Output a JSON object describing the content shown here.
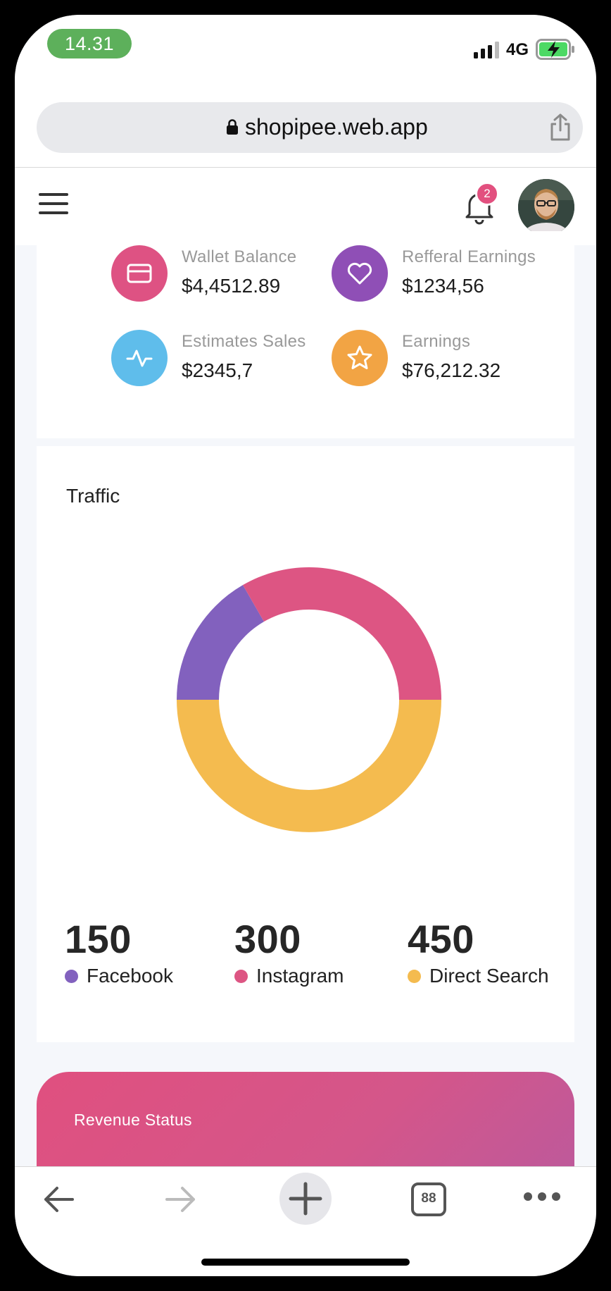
{
  "status_bar": {
    "time": "14.31",
    "network": "4G"
  },
  "browser": {
    "url": "shopipee.web.app",
    "tab_count": "88"
  },
  "header": {
    "notification_count": "2"
  },
  "stats": [
    {
      "label": "Wallet Balance",
      "value": "$4,4512.89",
      "icon": "card-icon",
      "color": "#de5283"
    },
    {
      "label": "Refferal Earnings",
      "value": "$1234,56",
      "icon": "heart-icon",
      "color": "#8f4fb6"
    },
    {
      "label": "Estimates Sales",
      "value": "$2345,7",
      "icon": "pulse-icon",
      "color": "#5fbdeb"
    },
    {
      "label": "Earnings",
      "value": "$76,212.32",
      "icon": "star-icon",
      "color": "#f2a444"
    }
  ],
  "traffic": {
    "title": "Traffic",
    "items": [
      {
        "value": "150",
        "label": "Facebook",
        "color": "#8261be"
      },
      {
        "value": "300",
        "label": "Instagram",
        "color": "#dd5583"
      },
      {
        "value": "450",
        "label": "Direct Search",
        "color": "#f4bb4f"
      }
    ]
  },
  "chart_data": {
    "type": "pie",
    "categories": [
      "Facebook",
      "Instagram",
      "Direct Search"
    ],
    "values": [
      150,
      300,
      450
    ],
    "colors": [
      "#8261be",
      "#dd5583",
      "#f4bb4f"
    ],
    "title": "Traffic"
  },
  "revenue": {
    "title": "Revenue Status"
  }
}
